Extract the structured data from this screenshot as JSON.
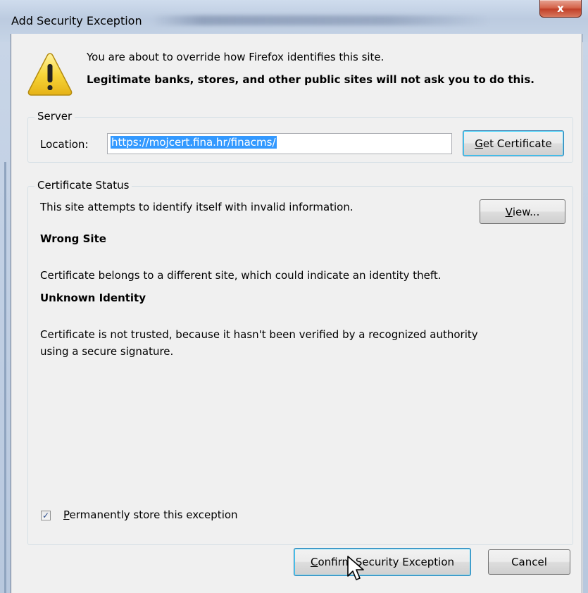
{
  "window": {
    "title": "Add Security Exception",
    "close_label": "x"
  },
  "message": {
    "line1": "You are about to override how Firefox identifies this site.",
    "line2": "Legitimate banks, stores, and other public sites will not ask you to do this."
  },
  "server": {
    "legend": "Server",
    "location_label": "Location:",
    "location_value": "https://mojcert.fina.hr/finacms/",
    "get_certificate_underlined": "G",
    "get_certificate_rest": "et Certificate"
  },
  "status": {
    "legend": "Certificate Status",
    "intro": "This site attempts to identify itself with invalid information.",
    "view_underlined": "V",
    "view_rest": "iew...",
    "wrong_site_heading": "Wrong Site",
    "wrong_site_text": "Certificate belongs to a different site, which could indicate an identity theft.",
    "unknown_identity_heading": "Unknown Identity",
    "unknown_identity_text1": "Certificate is not trusted, because it hasn't been verified by a recognized authority",
    "unknown_identity_text2": "using a secure signature."
  },
  "options": {
    "permanently_store_checked": true,
    "permanently_store_underlined": "P",
    "permanently_store_rest": "ermanently store this exception"
  },
  "buttons": {
    "confirm_underlined": "C",
    "confirm_rest": "onfirm Security Exception",
    "cancel": "Cancel"
  },
  "colors": {
    "selection": "#3399ff",
    "focus_border": "#3c7fb1",
    "warning_yellow": "#f5d33c"
  },
  "icons": [
    "warning-icon",
    "close-icon",
    "checkmark-icon",
    "mouse-cursor-icon"
  ]
}
